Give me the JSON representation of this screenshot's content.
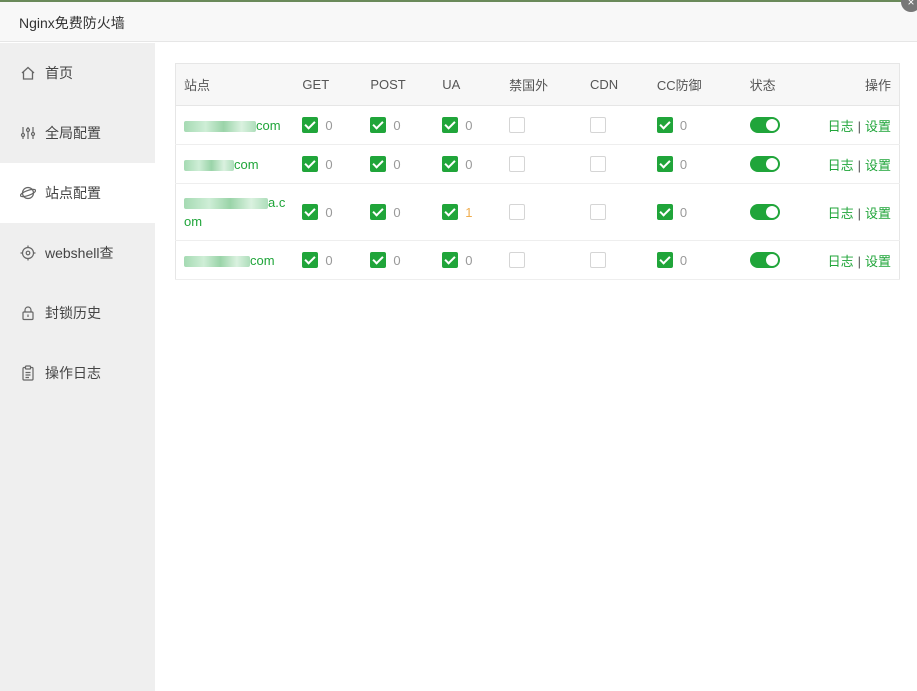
{
  "window": {
    "title": "Nginx免费防火墙",
    "close_glyph": "×"
  },
  "sidebar": {
    "items": [
      {
        "label": "首页",
        "icon": "home-icon"
      },
      {
        "label": "全局配置",
        "icon": "sliders-icon"
      },
      {
        "label": "站点配置",
        "icon": "globe-icon",
        "active": true
      },
      {
        "label": "webshell查",
        "icon": "target-icon"
      },
      {
        "label": "封锁历史",
        "icon": "lock-icon"
      },
      {
        "label": "操作日志",
        "icon": "clipboard-icon"
      }
    ]
  },
  "table": {
    "headers": [
      "站点",
      "GET",
      "POST",
      "UA",
      "禁国外",
      "CDN",
      "CC防御",
      "状态",
      "操作"
    ],
    "rows": [
      {
        "site_suffix": "com",
        "site_suffix2": "",
        "get": "0",
        "post": "0",
        "ua": "0",
        "cc": "0"
      },
      {
        "site_suffix": "com",
        "site_suffix2": "",
        "get": "0",
        "post": "0",
        "ua": "0",
        "cc": "0"
      },
      {
        "site_suffix": "a.c",
        "site_suffix2": "om",
        "get": "0",
        "post": "0",
        "ua": "1",
        "cc": "0"
      },
      {
        "site_suffix": "com",
        "site_suffix2": "",
        "get": "0",
        "post": "0",
        "ua": "0",
        "cc": "0"
      }
    ],
    "actions": {
      "log": "日志",
      "separator": "|",
      "settings": "设置"
    }
  },
  "colors": {
    "accent": "#20a53a",
    "warning": "#f0ad4e",
    "sidebar_bg": "#efefef"
  }
}
